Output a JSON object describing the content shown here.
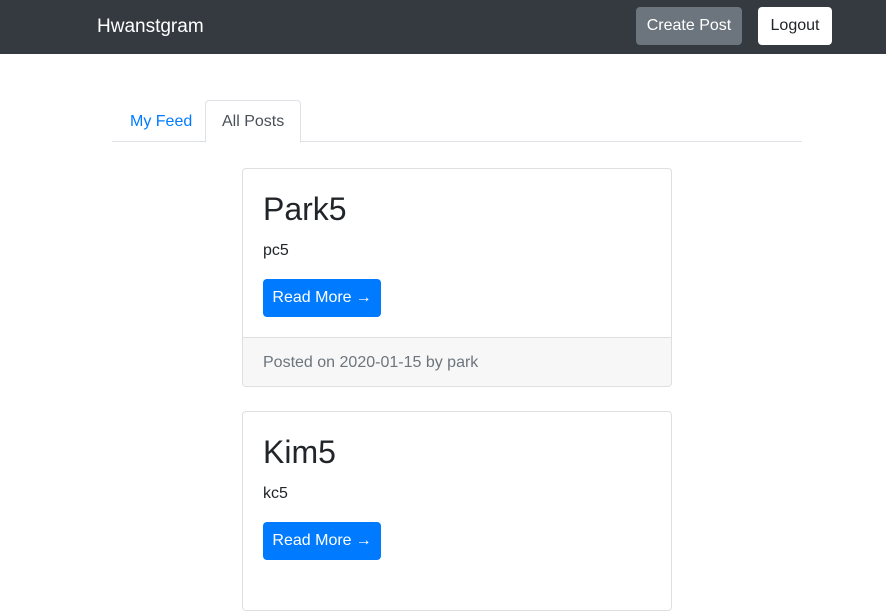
{
  "navbar": {
    "brand": "Hwanstgram",
    "create_post_label": "Create Post",
    "logout_label": "Logout"
  },
  "tabs": [
    {
      "label": "My Feed",
      "active": false
    },
    {
      "label": "All Posts",
      "active": true
    }
  ],
  "posts": [
    {
      "title": "Park5",
      "text": "pc5",
      "read_more_label": "Read More",
      "arrow": "→",
      "footer_prefix": "Posted on",
      "date": "2020-01-15",
      "footer_by": "by",
      "author": "park"
    },
    {
      "title": "Kim5",
      "text": "kc5",
      "read_more_label": "Read More",
      "arrow": "→"
    }
  ],
  "colors": {
    "navbar_bg": "#343a40",
    "primary": "#007bff",
    "secondary": "#6c757d"
  }
}
